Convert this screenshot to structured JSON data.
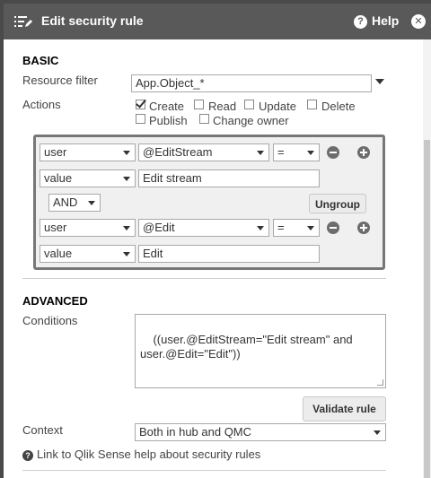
{
  "titlebar": {
    "title": "Edit security rule",
    "help_label": "Help",
    "help_icon_glyph": "?",
    "close_glyph": "✕"
  },
  "basic": {
    "section_title": "BASIC",
    "resource_filter_label": "Resource filter",
    "resource_filter_value": "App.Object_*",
    "actions_label": "Actions",
    "actions": [
      {
        "label": "Create",
        "checked": true
      },
      {
        "label": "Read",
        "checked": false
      },
      {
        "label": "Update",
        "checked": false
      },
      {
        "label": "Delete",
        "checked": false
      },
      {
        "label": "Publish",
        "checked": false
      },
      {
        "label": "Change owner",
        "checked": false
      }
    ]
  },
  "condition_group": {
    "row1": {
      "type": "user",
      "attribute": "@EditStream",
      "operator": "="
    },
    "row1_value": {
      "type": "value",
      "value": "Edit stream"
    },
    "combinator": "AND",
    "ungroup_label": "Ungroup",
    "row2": {
      "type": "user",
      "attribute": "@Edit",
      "operator": "="
    },
    "row2_value": {
      "type": "value",
      "value": "Edit"
    }
  },
  "advanced": {
    "section_title": "ADVANCED",
    "conditions_label": "Conditions",
    "conditions_value": "((user.@EditStream=\"Edit stream\" and\nuser.@Edit=\"Edit\"))",
    "validate_label": "Validate rule",
    "context_label": "Context",
    "context_value": "Both in hub and QMC",
    "help_link": "Link to Qlik Sense help about security rules",
    "help_link_icon_glyph": "?"
  },
  "colors": {
    "titlebar_bg": "#595959",
    "group_border": "#777777",
    "group_bg": "#f0f0f0"
  }
}
